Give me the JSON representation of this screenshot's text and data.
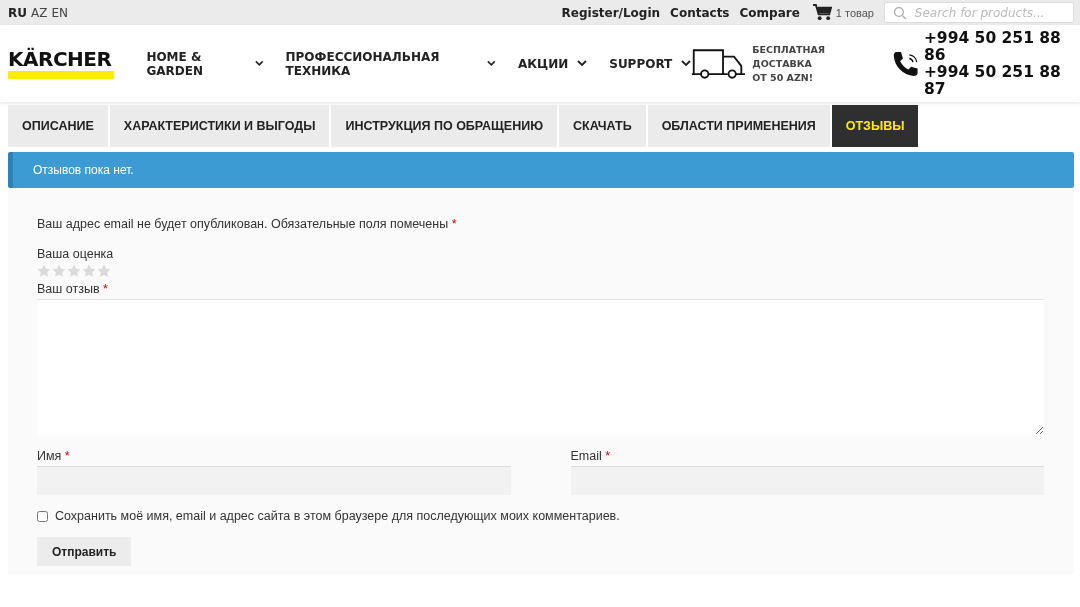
{
  "top_bar": {
    "languages": [
      {
        "label": "RU",
        "selected": true
      },
      {
        "label": "AZ",
        "selected": false
      },
      {
        "label": "EN",
        "selected": false
      }
    ],
    "links": [
      "Register/Login",
      "Contacts",
      "Compare"
    ],
    "cart": "1 товар",
    "search": {
      "placeholder": "Search for products..."
    }
  },
  "header": {
    "logo": "KÄRCHER",
    "nav": [
      {
        "label": "HOME & GARDEN"
      },
      {
        "label": "ПРОФЕССИОНАЛЬНАЯ ТЕХНИКА"
      },
      {
        "label": "АКЦИИ"
      },
      {
        "label": "SUPPORT"
      }
    ],
    "delivery": [
      "БЕСПЛАТНАЯ ДОСТАВКА",
      "ОТ 50 AZN!"
    ],
    "phones": [
      "+994 50 251 88 86",
      "+994 50 251 88 87"
    ]
  },
  "tabs": [
    {
      "label": "ОПИСАНИЕ",
      "selected": false
    },
    {
      "label": "ХАРАКТЕРИСТИКИ И ВЫГОДЫ",
      "selected": false
    },
    {
      "label": "ИНСТРУКЦИЯ ПО ОБРАЩЕНИЮ",
      "selected": false
    },
    {
      "label": "СКАЧАТЬ",
      "selected": false
    },
    {
      "label": "ОБЛАСТИ ПРИМЕНЕНИЯ",
      "selected": false
    },
    {
      "label": "ОТЗЫВЫ",
      "selected": true
    }
  ],
  "notice": "Отзывов пока нет.",
  "form": {
    "note": "Ваш адрес email не будет опубликован. Обязательные поля помечены",
    "note_mark": "*",
    "rating": {
      "label": "Ваша оценка",
      "stars": 0
    },
    "review": {
      "label": "Ваш отзыв",
      "mark": "*"
    },
    "name": {
      "label": "Имя",
      "mark": "*"
    },
    "email": {
      "label": "Email",
      "mark": "*"
    },
    "save": {
      "label": "Сохранить моё имя, email и адрес сайта в этом браузере для последующих моих комментариев.",
      "checked": false
    },
    "submit": "Отправить"
  }
}
